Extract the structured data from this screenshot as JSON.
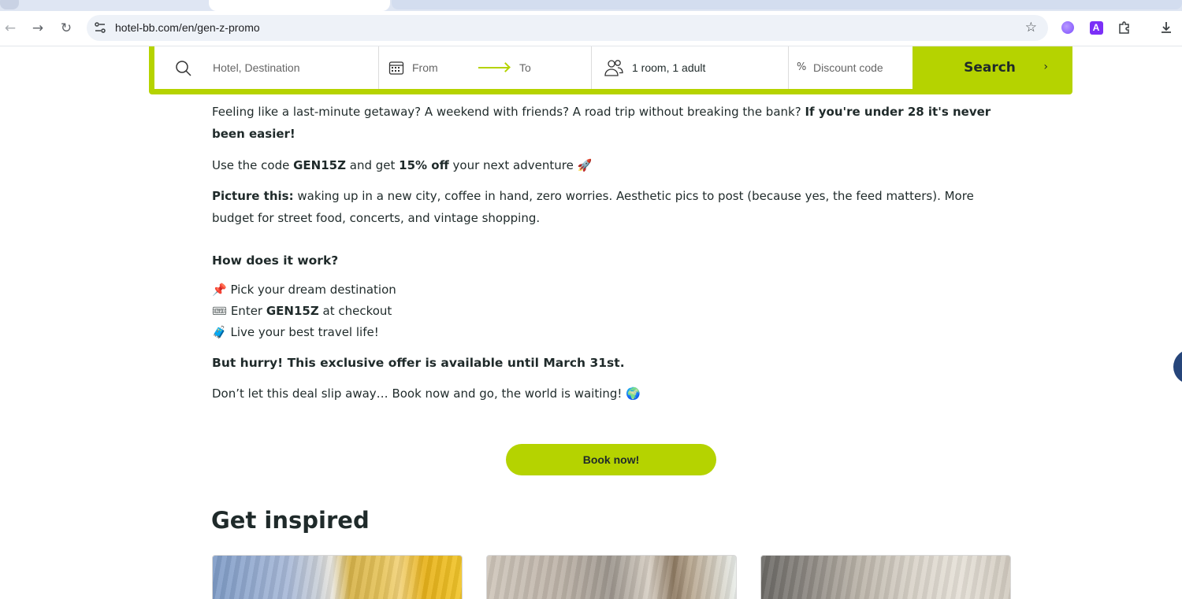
{
  "browser": {
    "url": "hotel-bb.com/en/gen-z-promo",
    "back_icon": "←",
    "forward_icon": "→",
    "reload_icon": "↻",
    "star_icon": "☆",
    "extension_a_label": "A"
  },
  "search": {
    "destination_placeholder": "Hotel, Destination",
    "from_label": "From",
    "to_label": "To",
    "guests_value": "1 room, 1 adult",
    "discount_placeholder": "Discount code",
    "discount_icon": "%",
    "button_label": "Search",
    "button_chevron": "›"
  },
  "article": {
    "p1_text": "Feeling like a last-minute getaway? A weekend with friends? A road trip without breaking the bank? ",
    "p1_bold": "If you're under 28 it's never been easier!",
    "p2_pre": "Use the code ",
    "p2_code": "GEN15Z",
    "p2_mid": " and get ",
    "p2_discount": "15% off",
    "p2_post": " your next adventure ",
    "p2_emoji": "🚀",
    "p3_bold": "Picture this:",
    "p3_text": " waking up in a new city, coffee in hand, zero worries. Aesthetic pics to post (because yes, the feed matters). More budget for street food, concerts, and vintage shopping.",
    "how_heading": "How does it work?",
    "steps": [
      {
        "emoji": "📌",
        "pre": "Pick your dream destination",
        "bold": "",
        "post": ""
      },
      {
        "emoji": "🎟",
        "pre": "Enter ",
        "bold": "GEN15Z",
        "post": " at checkout"
      },
      {
        "emoji": "🧳",
        "pre": "Live your best travel life!",
        "bold": "",
        "post": ""
      }
    ],
    "hurry_text": "But hurry! This exclusive offer is available until March 31st.",
    "closing_text": "Don’t let this deal slip away… Book now and go, the world is waiting! ",
    "closing_emoji": "🌍"
  },
  "cta": {
    "book_label": "Book now!"
  },
  "inspired": {
    "heading": "Get inspired",
    "cards": [
      {
        "alt": "hotel room with blue city mural and yellow curtains"
      },
      {
        "alt": "hotel room with grey landscape mural"
      },
      {
        "alt": "hotel room with black and white mural"
      }
    ]
  },
  "colors": {
    "accent": "#b5d300",
    "text": "#1f2a2a",
    "chat_button": "#26457a"
  }
}
